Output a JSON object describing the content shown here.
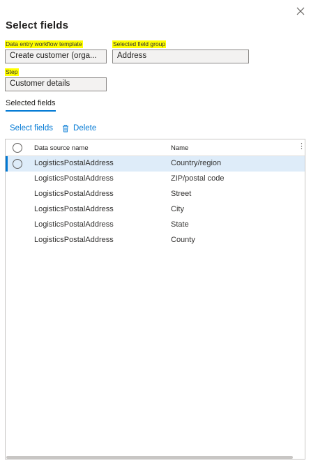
{
  "panel": {
    "title": "Select fields"
  },
  "fields": {
    "template_label": "Data entry workflow template",
    "template_value": "Create customer (orga...",
    "group_label": "Selected field group",
    "group_value": "Address",
    "step_label": "Step",
    "step_value": "Customer details"
  },
  "tabs": {
    "selected_fields": "Selected fields"
  },
  "toolbar": {
    "select_label": "Select fields",
    "delete_label": "Delete",
    "delete_icon": "trash-icon"
  },
  "grid": {
    "columns": [
      "Data source name",
      "Name"
    ],
    "more_icon": "⋮",
    "rows": [
      {
        "source": "LogisticsPostalAddress",
        "name": "Country/region",
        "selected": true
      },
      {
        "source": "LogisticsPostalAddress",
        "name": "ZIP/postal code",
        "selected": false
      },
      {
        "source": "LogisticsPostalAddress",
        "name": "Street",
        "selected": false
      },
      {
        "source": "LogisticsPostalAddress",
        "name": "City",
        "selected": false
      },
      {
        "source": "LogisticsPostalAddress",
        "name": "State",
        "selected": false
      },
      {
        "source": "LogisticsPostalAddress",
        "name": "County",
        "selected": false
      }
    ]
  },
  "colors": {
    "accent": "#0078d4",
    "highlight": "#ffff00",
    "selected_row": "#deecf9"
  }
}
